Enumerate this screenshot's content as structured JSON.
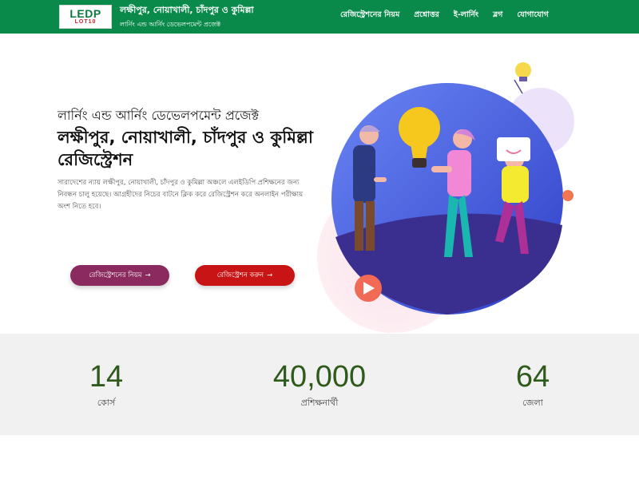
{
  "header": {
    "logo_main": "LEDP",
    "logo_sub": "LOT10",
    "title": "লক্ষীপুর, নোয়াখালী, চাঁদপুর ও কুমিল্লা",
    "subtitle": "লার্নিং এন্ড আর্নিং ডেভেলপমেন্ট প্রজেক্ট",
    "nav": [
      "রেজিস্ট্রেশনের নিয়ম",
      "প্রশ্নোত্তর",
      "ই-লার্নিং",
      "ব্লগ",
      "যোগাযোগ"
    ]
  },
  "hero": {
    "kicker": "লার্নিং এন্ড আর্নিং ডেভেলপমেন্ট প্রজেক্ট",
    "title": "লক্ষীপুর, নোয়াখালী, চাঁদপুর ও কুমিল্লা রেজিস্ট্রেশন",
    "description": "সারাদেশের ন্যায় লক্ষীপুর, নোয়াখালী, চাঁদপুর ও কুমিল্লা অঞ্চলে এলইডিপি প্রশিক্ষনের জন্য নিবন্ধন চালু হয়েছে। আগ্রহীদের নিচের বাটনে ক্লিক করে রেজিস্ট্রেশন করে অনলাইন পরীক্ষায় অংশ নিতে হবে।",
    "btn_rules": "রেজিস্ট্রেশনের নিয়ম",
    "btn_register": "রেজিস্ট্রেশন করুন",
    "arrow": "→"
  },
  "illustration": {
    "icons": [
      "lightbulb-icon",
      "play-icon"
    ]
  },
  "stats": [
    {
      "value": "14",
      "label": "কোর্স"
    },
    {
      "value": "40,000",
      "label": "প্রশিক্ষনার্থী"
    },
    {
      "value": "64",
      "label": "জেলা"
    }
  ],
  "colors": {
    "header_bg": "#0a8a4a",
    "btn_rules": "#8b2a5e",
    "btn_register": "#c81414",
    "stat_number": "#2e5a1b",
    "stats_bg": "#f1f1f1"
  }
}
